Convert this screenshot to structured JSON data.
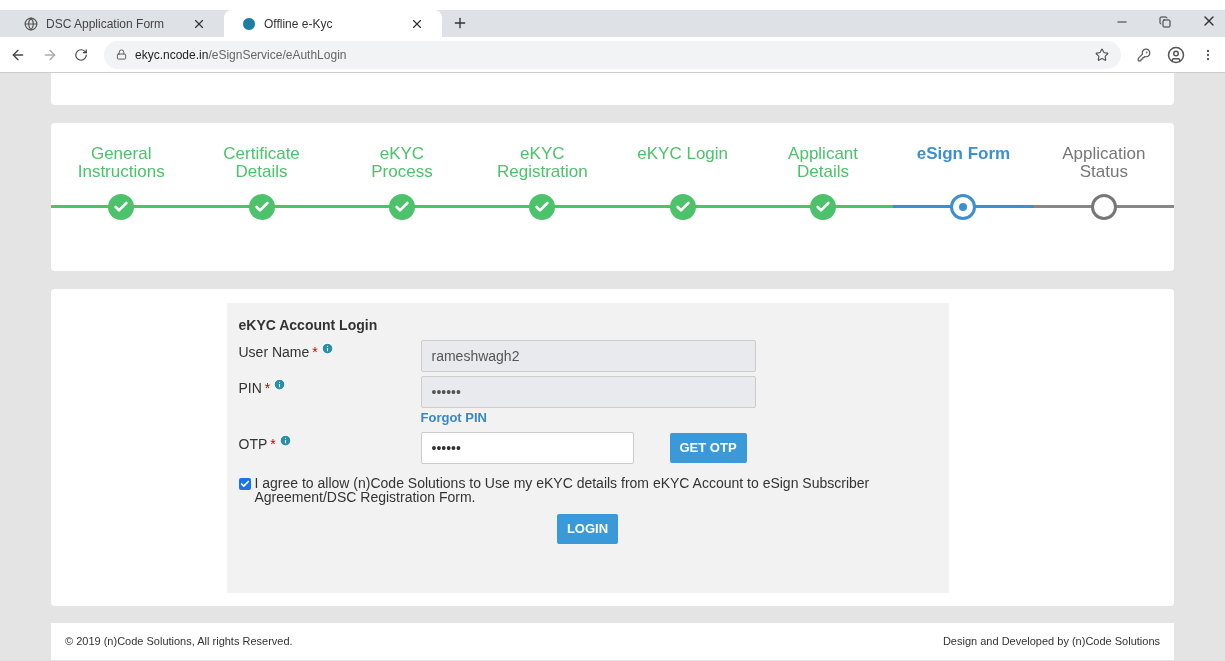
{
  "browser": {
    "tabs": [
      {
        "title": "DSC Application Form",
        "selected": false,
        "kind": "globe"
      },
      {
        "title": "Offline e-Kyc",
        "selected": true,
        "kind": "logo"
      }
    ],
    "url_host": "ekyc.ncode.in",
    "url_path": "/eSignService/eAuthLogin"
  },
  "steps": [
    {
      "label": "General Instructions",
      "kind": "done"
    },
    {
      "label": "Certificate Details",
      "kind": "done"
    },
    {
      "label": "eKYC Process",
      "kind": "done"
    },
    {
      "label": "eKYC Registration",
      "kind": "done"
    },
    {
      "label": "eKYC Login",
      "kind": "done"
    },
    {
      "label": "Applicant Details",
      "kind": "done"
    },
    {
      "label": "eSign Form",
      "kind": "current"
    },
    {
      "label": "Application Status",
      "kind": "pending"
    }
  ],
  "form": {
    "title": "eKYC Account Login",
    "fields": [
      {
        "label": "User Name",
        "required": "*",
        "value": "rameshwagh2",
        "disabled": true,
        "kind": "text"
      },
      {
        "label": "PIN",
        "required": "*",
        "value": "••••••",
        "disabled": true,
        "kind": "password",
        "link": "Forgot PIN"
      },
      {
        "label": "OTP",
        "required": "*",
        "value": "••••••",
        "disabled": false,
        "kind": "otp",
        "button": "GET OTP"
      }
    ],
    "consent": {
      "text": "I agree to allow (n)Code Solutions to Use my eKYC details from eKYC Account to eSign Subscriber Agreement/DSC Registration Form.",
      "checked": true
    },
    "submit": "LOGIN"
  },
  "footer": {
    "left": "© 2019 (n)Code Solutions, All rights Reserved.",
    "right": "Design and Developed by (n)Code Solutions"
  }
}
